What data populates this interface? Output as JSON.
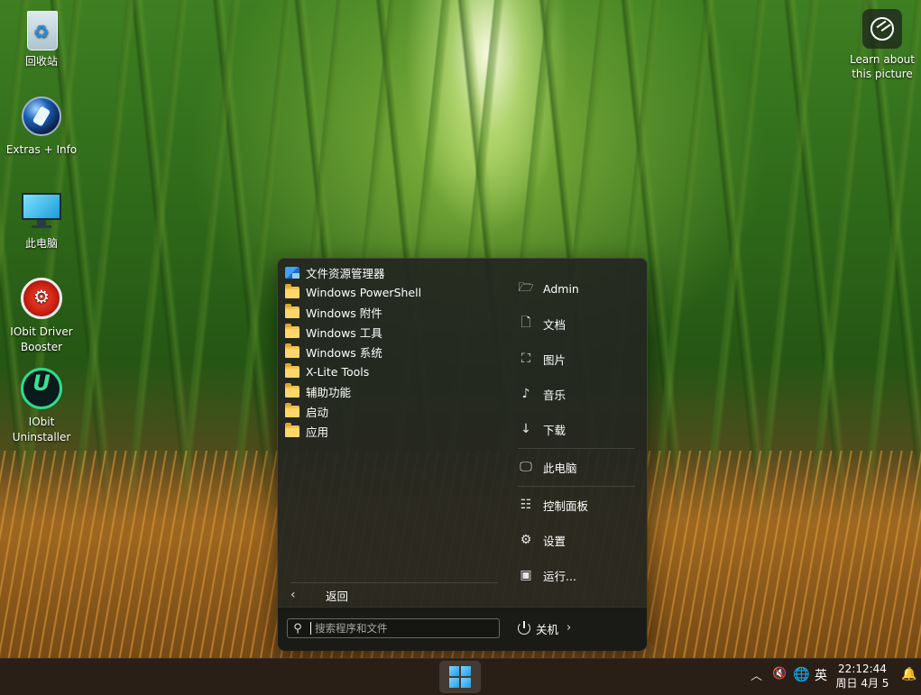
{
  "desktop": {
    "icons": [
      {
        "label": "回收站"
      },
      {
        "label": "Extras + Info"
      },
      {
        "label": "此电脑"
      },
      {
        "label": "IObit Driver Booster"
      },
      {
        "label": "IObit Uninstaller"
      }
    ],
    "learn_about": "Learn about this picture"
  },
  "start_menu": {
    "programs": [
      {
        "label": "文件资源管理器",
        "icon": "file-explorer-icon"
      },
      {
        "label": "Windows PowerShell",
        "icon": "folder-icon"
      },
      {
        "label": "Windows 附件",
        "icon": "folder-icon"
      },
      {
        "label": "Windows 工具",
        "icon": "folder-icon"
      },
      {
        "label": "Windows 系统",
        "icon": "folder-icon"
      },
      {
        "label": "X-Lite Tools",
        "icon": "folder-icon"
      },
      {
        "label": "辅助功能",
        "icon": "folder-icon"
      },
      {
        "label": "启动",
        "icon": "folder-icon"
      },
      {
        "label": "应用",
        "icon": "folder-icon"
      }
    ],
    "back_label": "返回",
    "places": [
      {
        "label": "Admin",
        "icon": "user-folder-icon"
      },
      {
        "label": "文档",
        "icon": "document-icon"
      },
      {
        "label": "图片",
        "icon": "picture-icon"
      },
      {
        "label": "音乐",
        "icon": "music-icon"
      },
      {
        "label": "下载",
        "icon": "download-icon"
      },
      {
        "label": "此电脑",
        "icon": "computer-icon"
      },
      {
        "label": "控制面板",
        "icon": "control-panel-icon"
      },
      {
        "label": "设置",
        "icon": "gear-icon"
      },
      {
        "label": "运行...",
        "icon": "run-icon"
      }
    ],
    "search_placeholder": "搜索程序和文件",
    "power_label": "关机"
  },
  "taskbar": {
    "ime_label": "英",
    "time": "22:12:44",
    "date": "周日 4月 5"
  },
  "colors": {
    "menu_bg": "#24261f",
    "taskbar_bg": "#2a1f17",
    "accent": "#1e9bea"
  }
}
